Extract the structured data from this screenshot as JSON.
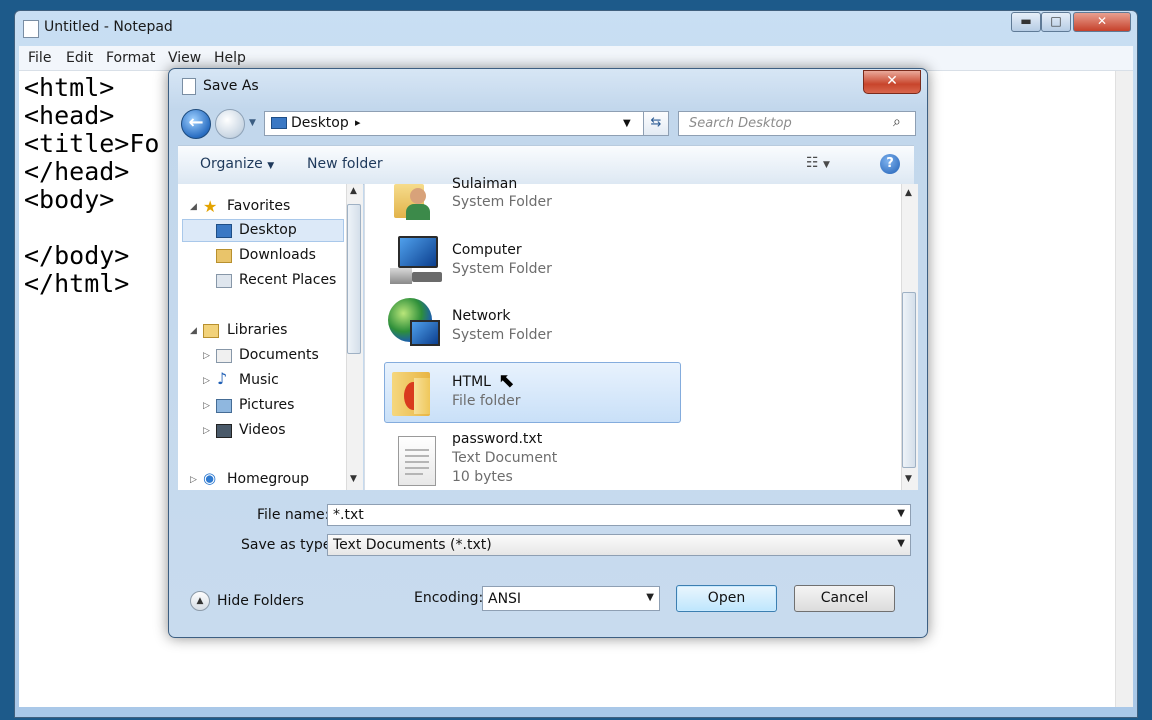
{
  "notepad": {
    "title": "Untitled - Notepad",
    "menu": [
      "File",
      "Edit",
      "Format",
      "View",
      "Help"
    ],
    "lines": [
      "<html>",
      "<head>",
      "<title>Fo",
      "</head>",
      "<body>",
      "",
      "</body>",
      "</html>"
    ],
    "caption_buttons": {
      "minimize": "▬",
      "maximize": "□",
      "close": "✕"
    }
  },
  "dialog": {
    "title": "Save As",
    "close_glyph": "✕",
    "address": {
      "location": "Desktop",
      "separator": "▸"
    },
    "search_placeholder": "Search Desktop",
    "toolbar": {
      "organize": "Organize",
      "new_folder": "New folder",
      "help": "?"
    },
    "nav": {
      "favorites": "Favorites",
      "favorites_items": [
        "Desktop",
        "Downloads",
        "Recent Places"
      ],
      "libraries": "Libraries",
      "libraries_items": [
        "Documents",
        "Music",
        "Pictures",
        "Videos"
      ],
      "homegroup": "Homegroup",
      "selected": "Desktop"
    },
    "files": [
      {
        "name": "Sulaiman",
        "type": "System Folder",
        "icon": "user-folder-icon"
      },
      {
        "name": "Computer",
        "type": "System Folder",
        "icon": "computer-icon"
      },
      {
        "name": "Network",
        "type": "System Folder",
        "icon": "network-icon"
      },
      {
        "name": "HTML",
        "type": "File folder",
        "icon": "folder-icon",
        "selected": true
      },
      {
        "name": "password.txt",
        "type": "Text Document",
        "size": "10 bytes",
        "icon": "text-file-icon"
      }
    ],
    "file_name_label": "File name:",
    "file_name_value": "*.txt",
    "save_as_type_label": "Save as type:",
    "save_as_type_value": "Text Documents (*.txt)",
    "hide_folders": "Hide Folders",
    "encoding_label": "Encoding:",
    "encoding_value": "ANSI",
    "open_label": "Open",
    "cancel_label": "Cancel"
  },
  "colors": {
    "accent": "#2a6ec2",
    "selection": "#c9e0f8",
    "folder": "#f2c14e"
  }
}
